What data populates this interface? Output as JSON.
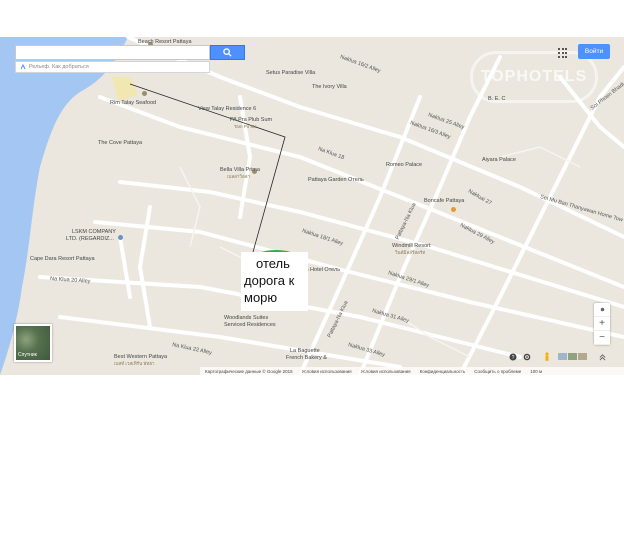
{
  "search": {
    "placeholder": "",
    "directions_label": "Рельеф. Как добраться"
  },
  "header": {
    "signin_label": "Войти"
  },
  "watermark_text": "TOPHOTELS",
  "satellite_label": "Спутник",
  "zoom": {
    "in": "+",
    "out": "−"
  },
  "annotation": {
    "line1": "отель",
    "line2": "дорога к",
    "line3": "морю"
  },
  "footer": {
    "items": [
      "Картографические данные © Google 2015",
      "Условия использования",
      "Условия использования",
      "Конфиденциальность",
      "Сообщить о проблеме",
      "100 м"
    ]
  },
  "places": {
    "beach_resort": "Beach Resort Pattaya",
    "setus": "Setus Paradise Villa",
    "ivory": "The Ivory Villa",
    "bec": "B. E. C",
    "rim_talay": "Rim Talay Seafood",
    "view_talay": "View Talay Residence 6",
    "pa_villa": "PA Pra Plub Sum",
    "pa_villa2": "Tam Po Ma",
    "cove": "The Cove Pattaya",
    "bella": "Bella Villa Prima",
    "bella_sub": "เบลล่าวิลล่า",
    "garden": "Pattaya Garden Отель",
    "romeo": "Romeo Palace",
    "aiyara": "Aiyara Palace",
    "boncafe": "Boncafe Pattaya",
    "lskm": "LSKM COMPANY",
    "lskm2": "LTD. (REGARDIZ...",
    "cape_dara": "Cape Dara Resort Pattaya",
    "windmill": "Windmill Resort",
    "windmill_sub": "วินด์มิลล์รีสอร์ท",
    "siam_hotel": "Siam Hotel Отель",
    "woodlands": "Woodlands Suites",
    "woodlands2": "Serviced Residences",
    "best_western": "Best Western Pattaya",
    "best_western_sub": "เบสท์ เวสเทิร์น พัทยา",
    "baguette": "La Baguette",
    "baguette2": "French Bakery &",
    "sei_mu_ban": "Sei Mu Ban Thanyawan Home Tow",
    "soi_phoen": "Soi Phoen Bhadi"
  },
  "streets": {
    "naklua_16_2": "Naklua 16/2 Alley",
    "naklua_25": "Naklua 25 Alley",
    "naklua_16_1": "Naklua 16/3 Alley",
    "naklua_18": "Na Klua 18",
    "naklua_27": "Nakluai 27",
    "naklua_29": "Naklua 29 Alley",
    "naklua_18_1": "Naklua 18/1 Alley",
    "naklua_20": "Na Klua 20 Alley",
    "naklua_29_1": "Naklua 29/1 Alley",
    "naklua_31": "Naklua 31 Alley",
    "naklua_22": "Na Klua 22 Alley",
    "naklua_33": "Naklua 33 Alley",
    "pattaya_naklua": "Pattaya-Na Klua",
    "pattaya_naklua2": "Pattaya-Na Klua"
  }
}
